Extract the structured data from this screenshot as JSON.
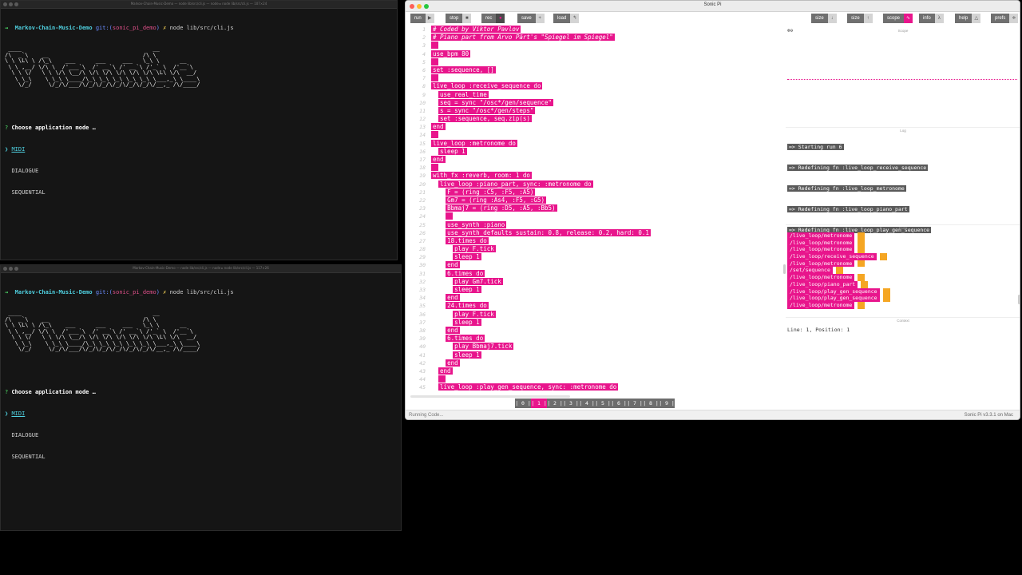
{
  "term_top": {
    "title": "Markov-Chain-Music-Demo — node lib/src/cli.js — node ▸ node lib/src/cli.js — 107×24",
    "prompt": {
      "arrow": "→",
      "dir": "Markov-Chain-Music-Demo",
      "git": "git:(",
      "branch": "sonic_pi_demo",
      "git_close": ")",
      "mark": "✗",
      "command": "node lib/src/cli.js"
    },
    "question": "Choose application mode …",
    "options": [
      "MIDI",
      "DIALOGUE",
      "SEQUENTIAL"
    ]
  },
  "term_bottom": {
    "title": "Markov-Chain-Music-Demo — node lib/src/cli.js — node ▸ node lib/src/cli.js — 117×26",
    "prompt": {
      "arrow": "→",
      "dir": "Markov-Chain-Music-Demo",
      "git": "git:(",
      "branch": "sonic_pi_demo",
      "git_close": ")",
      "mark": "✗",
      "command": "node lib/src/cli.js"
    },
    "question": "Choose application mode …",
    "options": [
      "MIDI",
      "DIALOGUE",
      "SEQUENTIAL"
    ]
  },
  "sonic_pi": {
    "title": "Sonic Pi",
    "toolbar": {
      "run": "run",
      "stop": "stop",
      "rec": "rec",
      "save": "save",
      "load": "load",
      "size1": "size",
      "size2": "size",
      "scope": "scope",
      "info": "info",
      "help": "help",
      "prefs": "prefs"
    },
    "code": [
      "# Coded by Viktor Pavlov",
      "# Piano part from Arvo Pärt's \"Spiegel im Spiegel\"",
      "",
      "use_bpm 80",
      "",
      "set :sequence, []",
      "",
      "live_loop :receive_sequence do",
      "  use_real_time",
      "  seq = sync \"/osc*/gen/sequence\"",
      "  s = sync \"/osc*/gen/steps\"",
      "  set :sequence, seq.zip(s)",
      "end",
      "",
      "live_loop :metronome do",
      "  sleep 1",
      "end",
      "",
      "with_fx :reverb, room: 1 do",
      "  live_loop :piano_part, sync: :metronome do",
      "    F = (ring :C5, :F5, :A5)",
      "    Gm7 = (ring :As4, :F5, :G5)",
      "    Bbmaj7 = (ring :D5, :A5, :Bb5)",
      "    ",
      "    use_synth :piano",
      "    use_synth_defaults sustain: 0.8, release: 0.2, hard: 0.1",
      "    18.times do",
      "      play F.tick",
      "      sleep 1",
      "    end",
      "    6.times do",
      "      play Gm7.tick",
      "      sleep 1",
      "    end",
      "    24.times do",
      "      play F.tick",
      "      sleep 1",
      "    end",
      "    6.times do",
      "      play Bbmaj7.tick",
      "      sleep 1",
      "    end",
      "  end",
      "  ",
      "  live_loop :play_gen_sequence, sync: :metronome do"
    ],
    "buffers": [
      "| 0 |",
      "| 1 |",
      "| 2 |",
      "| 3 |",
      "| 4 |",
      "| 5 |",
      "| 6 |",
      "| 7 |",
      "| 8 |",
      "| 9 |"
    ],
    "active_buffer": 1,
    "panels": {
      "scope": "Scope",
      "log": "Log",
      "cues": "Cues",
      "context": "Context"
    },
    "log": [
      "=> Starting run 6",
      "=> Redefining fn :live_loop_receive_sequence",
      "=> Redefining fn :live_loop_metronome",
      "=> Redefining fn :live_loop_piano_part",
      "=> Redefining fn :live_loop_play_gen_sequence"
    ],
    "cues": [
      "/live_loop/metronome",
      "/live_loop/metronome",
      "/live_loop/metronome",
      "/live_loop/receive_sequence",
      "/live_loop/metronome",
      "/set/sequence",
      "/live_loop/metronome",
      "/live_loop/piano_part",
      "/live_loop/play_gen_sequence",
      "/live_loop/play_gen_sequence",
      "/live_loop/metronome"
    ],
    "context": "Line: 1,  Position: 1",
    "status_left": "Running Code...",
    "status_right": "Sonic Pi v3.3.1 on Mac",
    "colors": {
      "accent": "#e8158c",
      "cue_value": "#f5a623"
    }
  }
}
